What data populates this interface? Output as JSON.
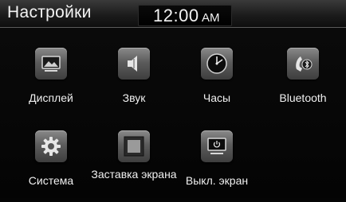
{
  "header": {
    "title": "Настройки",
    "time": "12:00",
    "ampm": "AM"
  },
  "tiles": [
    {
      "label": "Дисплей",
      "icon": "display-icon"
    },
    {
      "label": "Звук",
      "icon": "speaker-icon"
    },
    {
      "label": "Часы",
      "icon": "clock-icon"
    },
    {
      "label": "Bluetooth",
      "icon": "bluetooth-phone-icon"
    },
    {
      "label": "Система",
      "icon": "gear-icon"
    },
    {
      "label": "Заставка экрана",
      "icon": "screensaver-icon"
    },
    {
      "label": "Выкл. экран",
      "icon": "screen-off-icon"
    }
  ]
}
